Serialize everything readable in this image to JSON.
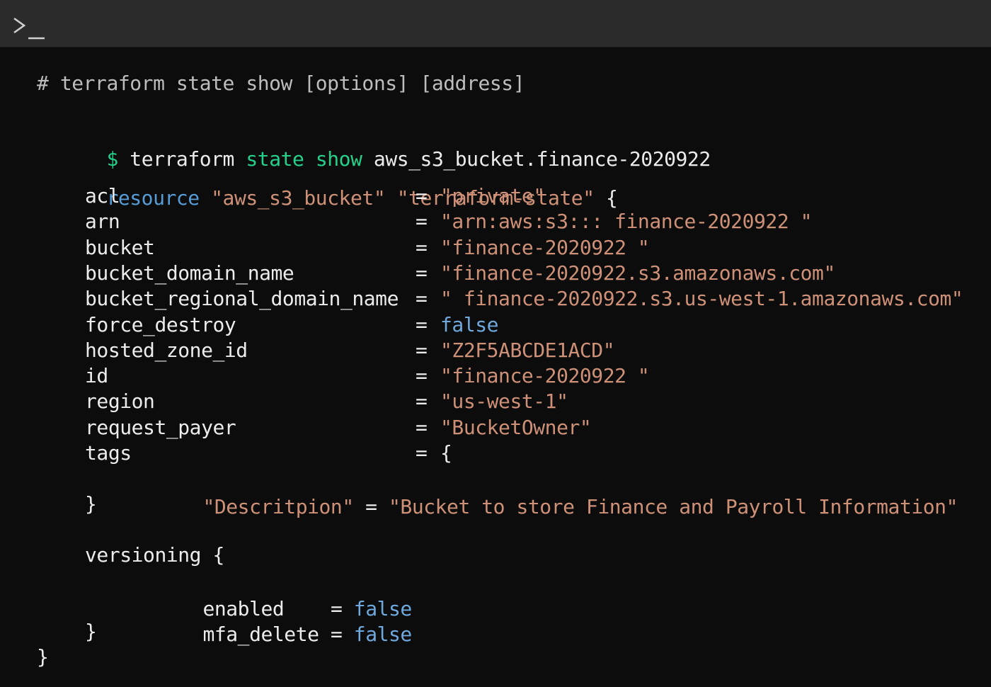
{
  "comment_line": "# terraform state show [options] [address]",
  "command": {
    "prompt": "$",
    "cmd": "terraform",
    "sub1": "state",
    "sub2": "show",
    "arg": "aws_s3_bucket.finance-2020922"
  },
  "resource": {
    "keyword": "resource",
    "type": "\"aws_s3_bucket\"",
    "name": "\"terraform-state\"",
    "open": "{",
    "attributes": [
      {
        "key": "acl",
        "value": "\"private\"",
        "kind": "string"
      },
      {
        "key": "arn",
        "value": "\"arn:aws:s3::: finance-2020922 \"",
        "kind": "string"
      },
      {
        "key": "bucket",
        "value": "\"finance-2020922 \"",
        "kind": "string"
      },
      {
        "key": "bucket_domain_name",
        "value": "\"finance-2020922.s3.amazonaws.com\"",
        "kind": "string"
      },
      {
        "key": "bucket_regional_domain_name",
        "value": "\" finance-2020922.s3.us-west-1.amazonaws.com\"",
        "kind": "string"
      },
      {
        "key": "force_destroy",
        "value": "false",
        "kind": "bool"
      },
      {
        "key": "hosted_zone_id",
        "value": "\"Z2F5ABCDE1ACD\"",
        "kind": "string"
      },
      {
        "key": "id",
        "value": "\"finance-2020922 \"",
        "kind": "string"
      },
      {
        "key": "region",
        "value": "\"us-west-1\"",
        "kind": "string"
      },
      {
        "key": "request_payer",
        "value": "\"BucketOwner\"",
        "kind": "string"
      },
      {
        "key": "tags",
        "value": "{",
        "kind": "brace"
      }
    ],
    "tags": {
      "key": "\"Descritpion\"",
      "value": "\"Bucket to store Finance and Payroll Information\"",
      "close": "}"
    },
    "versioning": {
      "label": "versioning {",
      "enabled_key": "enabled",
      "enabled_value": "false",
      "mfa_key": "mfa_delete",
      "mfa_value": "false",
      "close": "}"
    },
    "close": "}"
  },
  "equals": "=",
  "colors": {
    "background": "#0c0c0c",
    "titlebar": "#2b2b2b",
    "green": "#23d18b",
    "keyword_blue": "#569cd6",
    "string_orange": "#ce9178"
  },
  "icons": {
    "titlebar": "terminal-prompt-icon"
  }
}
